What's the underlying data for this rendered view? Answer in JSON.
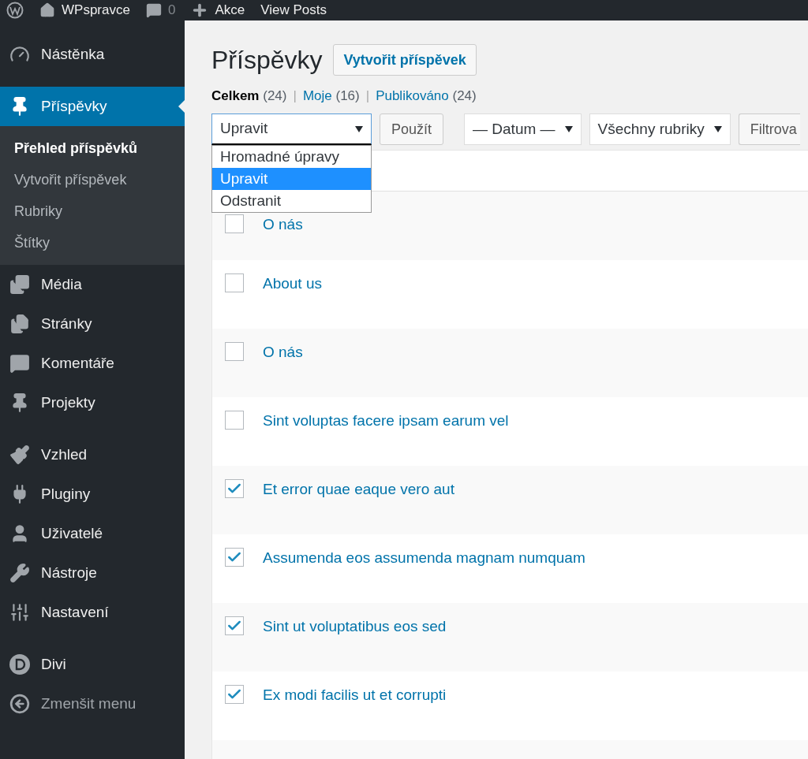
{
  "admin_bar": {
    "items": [
      {
        "label": "WPspravce"
      },
      {
        "label": "0"
      },
      {
        "label": "Akce"
      },
      {
        "label": "View Posts"
      }
    ]
  },
  "sidebar": {
    "groups": [
      {
        "items": [
          {
            "label": "Nástěnka",
            "kind": "item",
            "selected": false
          }
        ]
      },
      {
        "items": [
          {
            "label": "Příspěvky",
            "kind": "item",
            "selected": true,
            "children": [
              {
                "label": "Přehled příspěvků",
                "selected": true
              },
              {
                "label": "Vytvořit příspěvek",
                "selected": false
              },
              {
                "label": "Rubriky",
                "selected": false
              },
              {
                "label": "Štítky",
                "selected": false
              }
            ]
          },
          {
            "label": "Média",
            "kind": "item",
            "selected": false
          },
          {
            "label": "Stránky",
            "kind": "item",
            "selected": false
          },
          {
            "label": "Komentáře",
            "kind": "item",
            "selected": false
          },
          {
            "label": "Projekty",
            "kind": "item",
            "selected": false
          }
        ]
      },
      {
        "items": [
          {
            "label": "Vzhled",
            "kind": "item",
            "selected": false
          },
          {
            "label": "Pluginy",
            "kind": "item",
            "selected": false
          },
          {
            "label": "Uživatelé",
            "kind": "item",
            "selected": false
          },
          {
            "label": "Nástroje",
            "kind": "item",
            "selected": false
          },
          {
            "label": "Nastavení",
            "kind": "item",
            "selected": false
          }
        ]
      },
      {
        "items": [
          {
            "label": "Divi",
            "kind": "item",
            "selected": false
          },
          {
            "label": "Zmenšit menu",
            "kind": "collapse",
            "selected": false
          }
        ]
      }
    ]
  },
  "page": {
    "title": "Příspěvky",
    "add_button": "Vytvořit příspěvek"
  },
  "views": [
    {
      "label": "Celkem",
      "count": "(24)",
      "selected": true
    },
    {
      "separator": "|",
      "label": "Moje",
      "count": "(16)",
      "selected": false
    },
    {
      "separator": "|",
      "label": "Publikováno",
      "count": "(24)",
      "selected": false
    }
  ],
  "filters": {
    "bulk_action": {
      "value": "Upravit",
      "expanded": true,
      "options": [
        {
          "label": "Hromadné úpravy",
          "selected": false
        },
        {
          "label": "Upravit",
          "selected": true
        },
        {
          "label": "Odstranit",
          "selected": false
        }
      ]
    },
    "apply_button": "Použít",
    "date": {
      "value": "— Datum —"
    },
    "category": {
      "value": "Všechny rubriky"
    },
    "filter_button": "Filtrova"
  },
  "rows": [
    {
      "title": "O nás",
      "checked": false
    },
    {
      "title": "About us",
      "checked": false
    },
    {
      "title": "O nás",
      "checked": false
    },
    {
      "title": "Sint voluptas facere ipsam earum vel",
      "checked": false
    },
    {
      "title": "Et error quae eaque vero aut",
      "checked": true
    },
    {
      "title": "Assumenda eos assumenda magnam numquam",
      "checked": true
    },
    {
      "title": "Sint ut voluptatibus eos sed",
      "checked": true
    },
    {
      "title": "Ex modi facilis ut et corrupti",
      "checked": true
    }
  ]
}
